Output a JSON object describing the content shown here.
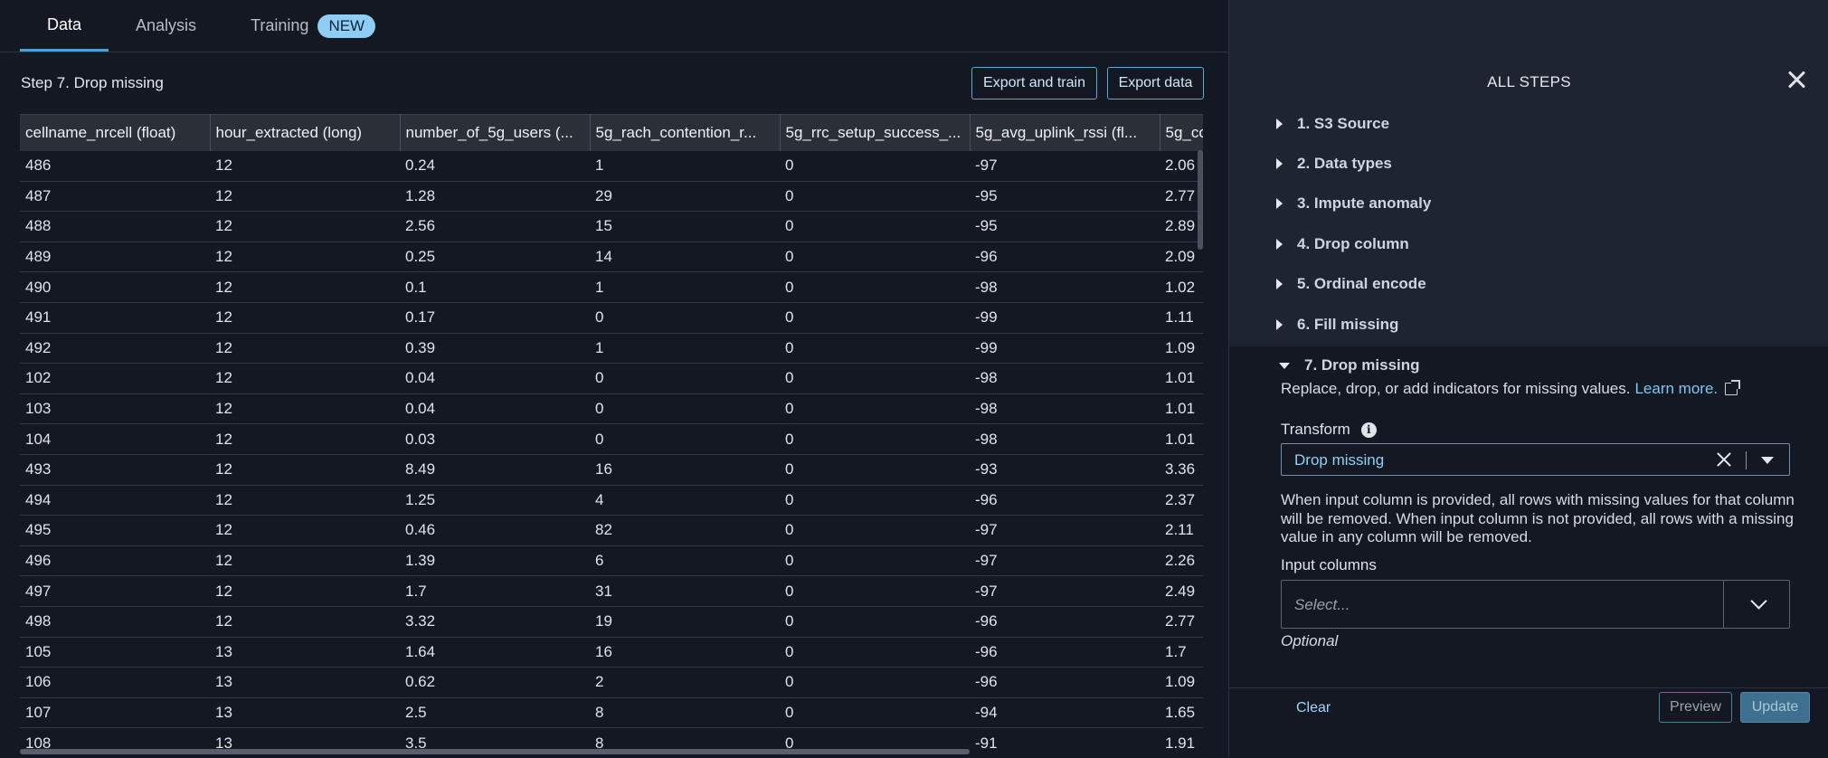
{
  "tabs": [
    {
      "label": "Data"
    },
    {
      "label": "Analysis"
    },
    {
      "label": "Training",
      "badge": "NEW"
    }
  ],
  "toolbar": {
    "step_title": "Step 7. Drop missing",
    "export_train_label": "Export and train",
    "export_data_label": "Export data"
  },
  "grid": {
    "columns": [
      "cellname_nrcell (float)",
      "hour_extracted (long)",
      "number_of_5g_users (...",
      "5g_rach_contention_r...",
      "5g_rrc_setup_success_...",
      "5g_avg_uplink_rssi (fl...",
      "5g_co"
    ],
    "rows": [
      [
        "486",
        "12",
        "0.24",
        "1",
        "0",
        "-97",
        "2.06"
      ],
      [
        "487",
        "12",
        "1.28",
        "29",
        "0",
        "-95",
        "2.77"
      ],
      [
        "488",
        "12",
        "2.56",
        "15",
        "0",
        "-95",
        "2.89"
      ],
      [
        "489",
        "12",
        "0.25",
        "14",
        "0",
        "-96",
        "2.09"
      ],
      [
        "490",
        "12",
        "0.1",
        "1",
        "0",
        "-98",
        "1.02"
      ],
      [
        "491",
        "12",
        "0.17",
        "0",
        "0",
        "-99",
        "1.11"
      ],
      [
        "492",
        "12",
        "0.39",
        "1",
        "0",
        "-99",
        "1.09"
      ],
      [
        "102",
        "12",
        "0.04",
        "0",
        "0",
        "-98",
        "1.01"
      ],
      [
        "103",
        "12",
        "0.04",
        "0",
        "0",
        "-98",
        "1.01"
      ],
      [
        "104",
        "12",
        "0.03",
        "0",
        "0",
        "-98",
        "1.01"
      ],
      [
        "493",
        "12",
        "8.49",
        "16",
        "0",
        "-93",
        "3.36"
      ],
      [
        "494",
        "12",
        "1.25",
        "4",
        "0",
        "-96",
        "2.37"
      ],
      [
        "495",
        "12",
        "0.46",
        "82",
        "0",
        "-97",
        "2.11"
      ],
      [
        "496",
        "12",
        "1.39",
        "6",
        "0",
        "-97",
        "2.26"
      ],
      [
        "497",
        "12",
        "1.7",
        "31",
        "0",
        "-97",
        "2.49"
      ],
      [
        "498",
        "12",
        "3.32",
        "19",
        "0",
        "-96",
        "2.77"
      ],
      [
        "105",
        "13",
        "1.64",
        "16",
        "0",
        "-96",
        "1.7"
      ],
      [
        "106",
        "13",
        "0.62",
        "2",
        "0",
        "-96",
        "1.09"
      ],
      [
        "107",
        "13",
        "2.5",
        "8",
        "0",
        "-94",
        "1.65"
      ],
      [
        "108",
        "13",
        "3.5",
        "8",
        "0",
        "-91",
        "1.91"
      ]
    ]
  },
  "panel": {
    "title": "ALL STEPS",
    "steps": [
      {
        "label": "1. S3 Source"
      },
      {
        "label": "2. Data types"
      },
      {
        "label": "3. Impute anomaly"
      },
      {
        "label": "4. Drop column"
      },
      {
        "label": "5. Ordinal encode"
      },
      {
        "label": "6. Fill missing"
      },
      {
        "label": "7. Drop missing"
      }
    ],
    "description": "Replace, drop, or add indicators for missing values.",
    "learn_more": "Learn more.",
    "transform_label": "Transform",
    "transform_value": "Drop missing",
    "help_text": "When input column is provided, all rows with missing values for that column will be removed. When input column is not provided, all rows with a missing value in any column will be removed.",
    "input_columns_label": "Input columns",
    "input_columns_placeholder": "Select...",
    "optional_label": "Optional",
    "clear_label": "Clear",
    "preview_label": "Preview",
    "update_label": "Update"
  }
}
